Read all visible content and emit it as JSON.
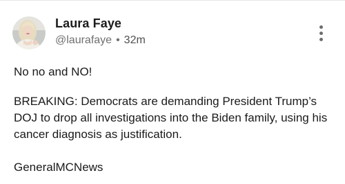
{
  "post": {
    "author": {
      "display_name": "Laura Faye",
      "handle": "@laurafaye",
      "separator": "•",
      "timestamp": "32m",
      "avatar_icon": "user-avatar-photo"
    },
    "menu_icon": "more-vertical-icon",
    "body": {
      "line1": "No no and NO!",
      "paragraph2": "BREAKING: Democrats are demanding President Trump’s DOJ to drop all investigations into the Biden family, using his cancer diagnosis as justification.",
      "source": "GeneralMCNews"
    },
    "colors": {
      "text": "#1a1a1a",
      "muted": "#6f6f6f",
      "background": "#ffffff"
    }
  }
}
